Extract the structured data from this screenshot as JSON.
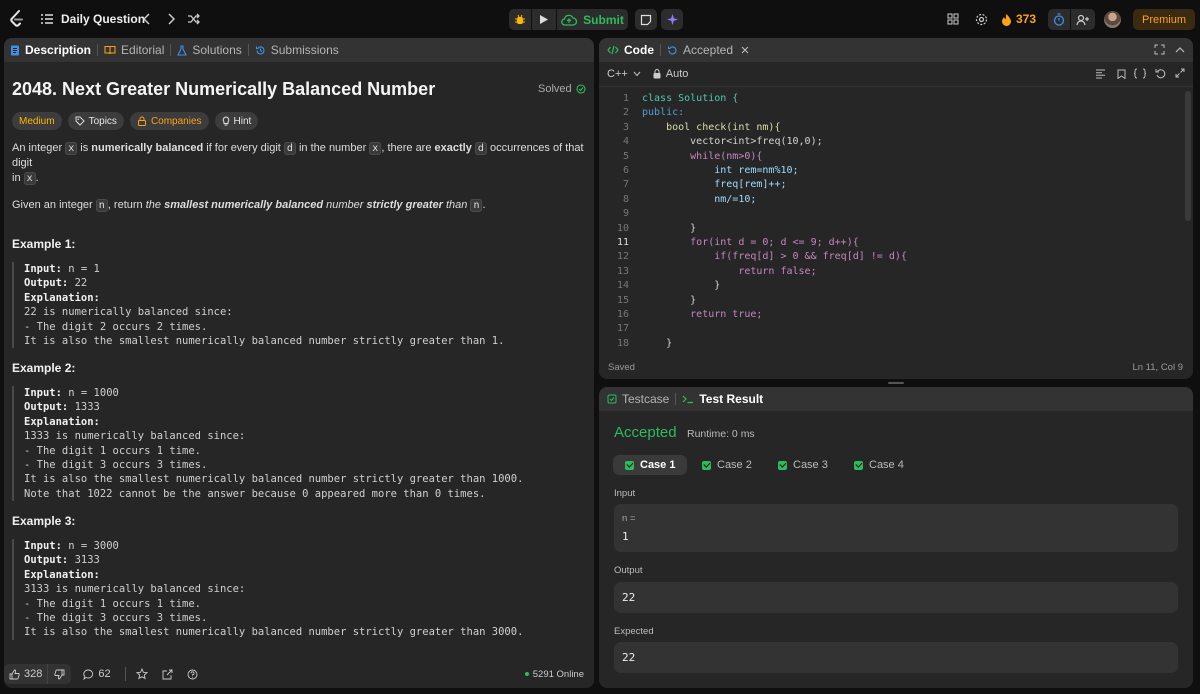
{
  "topbar": {
    "problem_list_label": "Daily Question",
    "submit_label": "Submit",
    "streak_count": "373",
    "premium_label": "Premium"
  },
  "description_panel": {
    "tabs": [
      {
        "label": "Description"
      },
      {
        "label": "Editorial"
      },
      {
        "label": "Solutions"
      },
      {
        "label": "Submissions"
      }
    ],
    "title": "2048. Next Greater Numerically Balanced Number",
    "solved_label": "Solved",
    "tags": {
      "difficulty": "Medium",
      "topics": "Topics",
      "companies": "Companies",
      "hint": "Hint"
    },
    "statement": {
      "p1_a": "An integer ",
      "p1_x": "x",
      "p1_b": " is ",
      "p1_bold1": "numerically balanced",
      "p1_c": " if for every digit ",
      "p1_d": "d",
      "p1_e": " in the number ",
      "p1_x2": "x",
      "p1_f": ", there are ",
      "p1_bold2": "exactly",
      "p1_d2": "d",
      "p1_g": " occurrences of that digit",
      "p1_h": "in ",
      "p1_x3": "x",
      "p1_i": ".",
      "p2_a": "Given an integer ",
      "p2_n": "n",
      "p2_b": ", return ",
      "p2_it1": "the ",
      "p2_bi1": "smallest numerically balanced",
      "p2_it2": " number ",
      "p2_bi2": "strictly greater",
      "p2_it3": " than ",
      "p2_n2": "n",
      "p2_c": "."
    },
    "examples": [
      {
        "title": "Example 1:",
        "input": "n = 1",
        "output": "22",
        "lines": [
          "22 is numerically balanced since:",
          "- The digit 2 occurs 2 times.",
          "It is also the smallest numerically balanced number strictly greater than 1."
        ]
      },
      {
        "title": "Example 2:",
        "input": "n = 1000",
        "output": "1333",
        "lines": [
          "1333 is numerically balanced since:",
          "- The digit 1 occurs 1 time.",
          "- The digit 3 occurs 3 times.",
          "It is also the smallest numerically balanced number strictly greater than 1000.",
          "Note that 1022 cannot be the answer because 0 appeared more than 0 times."
        ]
      },
      {
        "title": "Example 3:",
        "input": "n = 3000",
        "output": "3133",
        "lines": [
          "3133 is numerically balanced since:",
          "- The digit 1 occurs 1 time.",
          "- The digit 3 occurs 3 times.",
          "It is also the smallest numerically balanced number strictly greater than 3000."
        ]
      }
    ],
    "labels": {
      "input": "Input:",
      "output": "Output:",
      "explanation": "Explanation:"
    },
    "footer": {
      "likes": "328",
      "comments": "62",
      "online": "5291 Online"
    }
  },
  "code_panel": {
    "tab_code": "Code",
    "tab_accepted": "Accepted",
    "language": "C++",
    "mode": "Auto",
    "status": "Saved",
    "cursor": "Ln 11, Col 9",
    "lines": [
      "class Solution {",
      "public:",
      "    bool check(int nm){",
      "        vector<int>freq(10,0);",
      "        while(nm>0){",
      "            int rem=nm%10;",
      "            freq[rem]++;",
      "            nm/=10;",
      "",
      "        }",
      "        for(int d = 0; d <= 9; d++){",
      "            if(freq[d] > 0 && freq[d] != d){",
      "                return false;",
      "            }",
      "        }",
      "        return true;",
      "",
      "    }"
    ]
  },
  "result_panel": {
    "tab_testcase": "Testcase",
    "tab_result": "Test Result",
    "verdict": "Accepted",
    "runtime": "Runtime: 0 ms",
    "cases": [
      "Case 1",
      "Case 2",
      "Case 3",
      "Case 4"
    ],
    "input_label": "Input",
    "input_var": "n =",
    "input_value": "1",
    "output_label": "Output",
    "output_value": "22",
    "expected_label": "Expected",
    "expected_value": "22"
  },
  "colors": {
    "accent_green": "#2cbb5d",
    "medium_yellow": "#ffb800",
    "link_blue": "#3c91e6",
    "streak_orange": "#ffa116"
  }
}
